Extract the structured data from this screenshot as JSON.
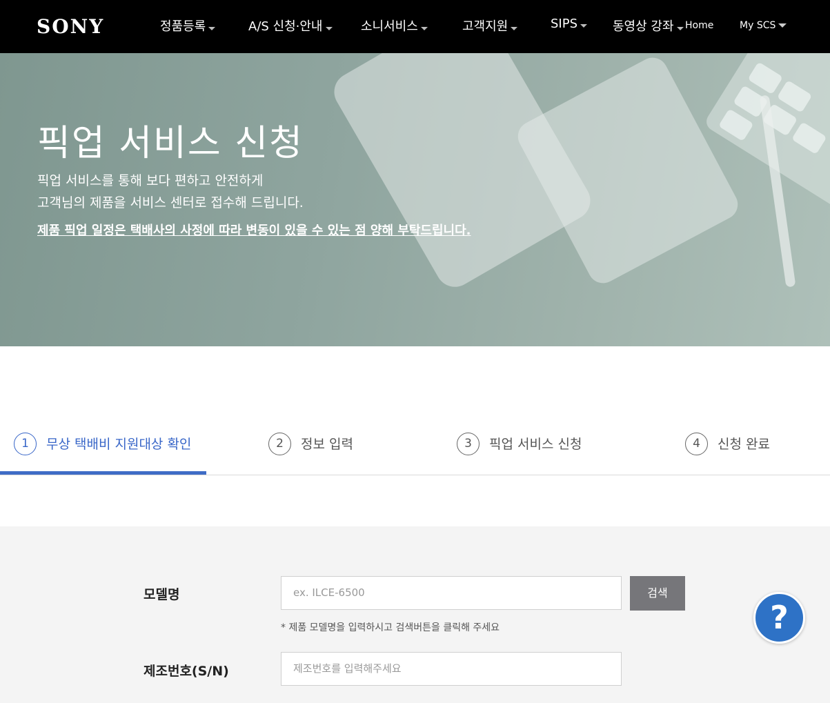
{
  "header": {
    "logo": "SONY",
    "nav": [
      "정품등록",
      "A/S 신청·안내",
      "소니서비스",
      "고객지원",
      "SIPS",
      "동영상 강좌"
    ],
    "home": "Home",
    "my_scs": "My SCS"
  },
  "hero": {
    "title": "픽업 서비스 신청",
    "desc_line1": "픽업 서비스를 통해 보다 편하고 안전하게",
    "desc_line2": "고객님의 제품을 서비스 센터로 접수해 드립니다.",
    "note": "제품 픽업 일정은 택배사의 사정에 따라 변동이 있을 수 있는 점 양해 부탁드립니다."
  },
  "steps": [
    {
      "num": "1",
      "label": "무상 택배비 지원대상 확인",
      "active": true
    },
    {
      "num": "2",
      "label": "정보 입력",
      "active": false
    },
    {
      "num": "3",
      "label": "픽업 서비스 신청",
      "active": false
    },
    {
      "num": "4",
      "label": "신청 완료",
      "active": false
    }
  ],
  "form": {
    "model_label": "모델명",
    "model_placeholder": "ex. ILCE-6500",
    "search_button": "검색",
    "model_hint": "* 제품 모델명을 입력하시고 검색버튼을 클릭해 주세요",
    "serial_label": "제조번호(S/N)",
    "serial_placeholder": "제조번호를 입력해주세요"
  },
  "help_button": "?",
  "colors": {
    "accent": "#3f6cc6",
    "header_bg": "#000000",
    "search_button": "#76767a",
    "help_button": "#2e72c6"
  }
}
